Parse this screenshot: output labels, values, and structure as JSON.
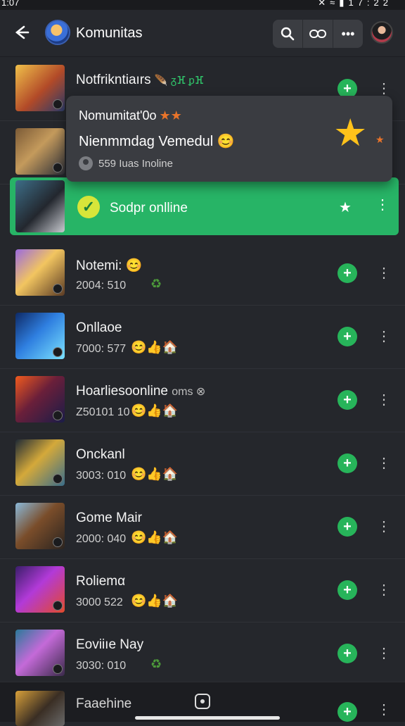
{
  "status_bar": {
    "time_left": "1:07",
    "time_right": "17:22"
  },
  "header": {
    "title": "Komunitas",
    "icons": {
      "back": "back-arrow-icon",
      "search": "search-icon",
      "link": "link-icon",
      "more": "more-dots-icon"
    }
  },
  "popup": {
    "title": "Nomumitat'0ᴏ",
    "title_stars": "★★",
    "subtitle": "Nienmmdag Vemedul",
    "subtitle_emoji": "😊",
    "count": "559 Iuas Inoline",
    "big_star": "★",
    "small_star": "★"
  },
  "highlight": {
    "label": "Sodpr onlline",
    "star": "★"
  },
  "rows": [
    {
      "name": "Notfrikntiaırs",
      "name_extra": "🪶 ᵹⴼ ᵱⴼ",
      "meta": "",
      "emojis": ""
    },
    {
      "name": "",
      "meta": "",
      "emojis": ""
    },
    {
      "name": "Notemi: 😊",
      "meta": "2004: 510",
      "emojis": "♻"
    },
    {
      "name": "Onllaoe",
      "meta": "7000: 577",
      "emojis": "😊👍🏠"
    },
    {
      "name": "Hoarliesoonline",
      "name_extra": "oms ⊗",
      "meta": "Z50101 10",
      "emojis": "😊👍🏠"
    },
    {
      "name": "Onckanl",
      "meta": "3003: 010",
      "emojis": "😊👍🏠"
    },
    {
      "name": "Gome Mair",
      "meta": "2000: 040",
      "emojis": "😊👍🏠"
    },
    {
      "name": "Roliemα",
      "meta": "3000 522",
      "emojis": "😊👍🏠"
    },
    {
      "name": "Eoviiıe Nay",
      "meta": "3030: 010",
      "emojis": "♻"
    }
  ],
  "bottom": {
    "name": "Faaehine"
  }
}
